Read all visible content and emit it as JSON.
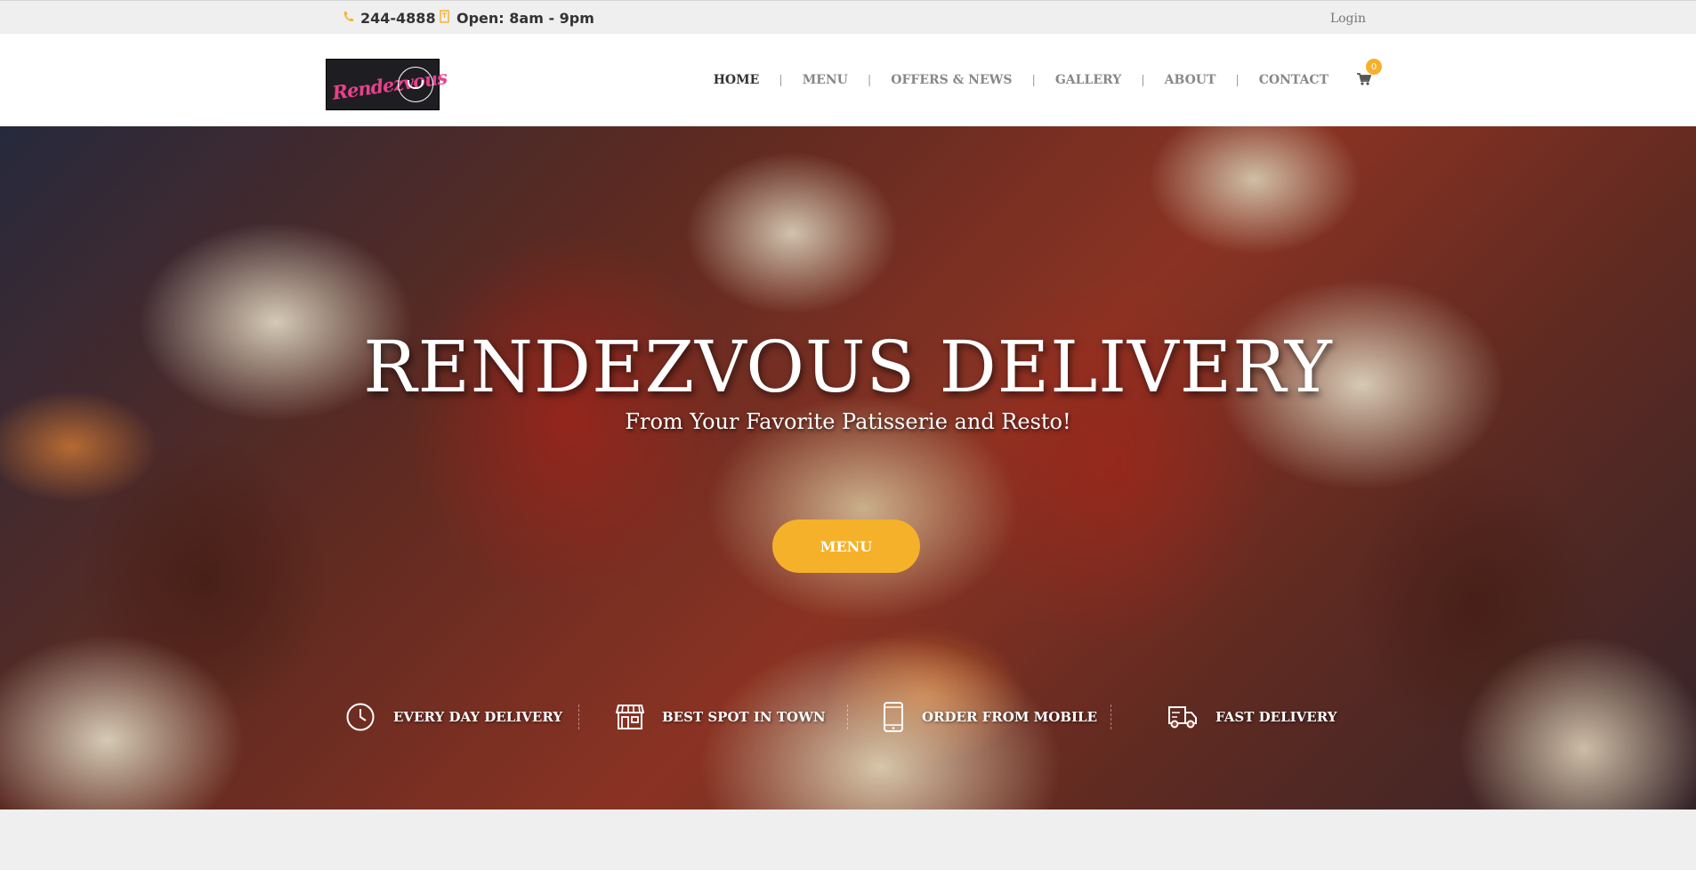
{
  "topbar": {
    "phone": "244-4888",
    "phone_icon": "phone-icon",
    "hours": "Open: 8am - 9pm",
    "hours_icon": "clock-icon",
    "login": "Login"
  },
  "header": {
    "logo_text": "Rendezvous",
    "nav": [
      {
        "label": "HOME",
        "active": true
      },
      {
        "label": "MENU"
      },
      {
        "label": "OFFERS & NEWS"
      },
      {
        "label": "GALLERY"
      },
      {
        "label": "ABOUT"
      },
      {
        "label": "CONTACT"
      }
    ],
    "separator": "|",
    "cart_count": "0",
    "cart_icon": "cart-icon"
  },
  "hero": {
    "title": "RENDEZVOUS DELIVERY",
    "subtitle": "From Your Favorite Patisserie and Resto!",
    "button": "MENU",
    "features": [
      {
        "icon": "clock-icon",
        "label": "EVERY DAY DELIVERY"
      },
      {
        "icon": "store-icon",
        "label": "BEST SPOT IN TOWN"
      },
      {
        "icon": "mobile-icon",
        "label": "ORDER FROM MOBILE"
      },
      {
        "icon": "truck-icon",
        "label": "FAST DELIVERY"
      }
    ]
  },
  "colors": {
    "accent": "#f5b12a",
    "logo_pink": "#e8418b",
    "nav_text": "#888888",
    "nav_active": "#333333"
  }
}
